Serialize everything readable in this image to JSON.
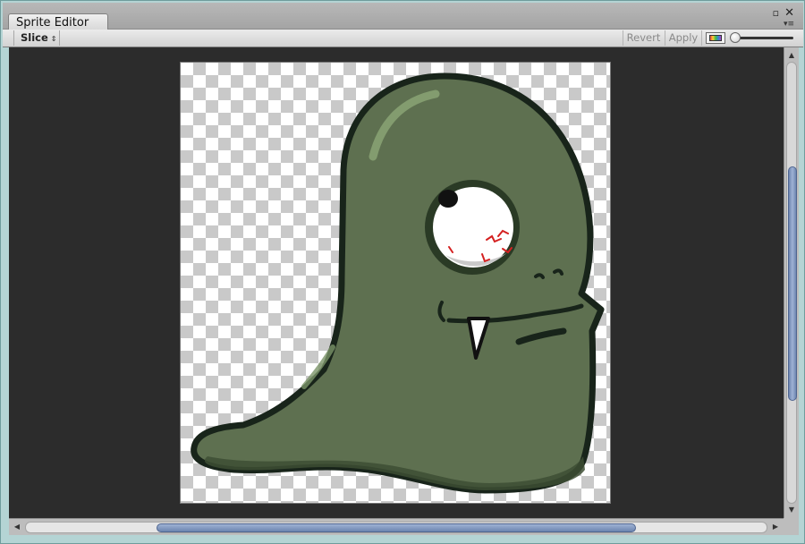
{
  "window": {
    "tab_title": "Sprite Editor",
    "maximize_icon": "maximize-icon",
    "close_icon": "close-icon",
    "menu_icon": "menu-icon"
  },
  "toolbar": {
    "slice_label": "Slice",
    "slice_arrow": "⇕",
    "revert_label": "Revert",
    "apply_label": "Apply",
    "color_toggle_icon": "rgb-channel-icon",
    "zoom_slider_level": 0.05
  },
  "canvas": {
    "background": "transparent-checkerboard",
    "sprite": "green-one-eyed-ghost-monster",
    "colors": {
      "body": "#5e7050",
      "outline": "#18241a",
      "highlight": "#8aa374",
      "eye_white": "#ffffff",
      "veins": "#d42020"
    }
  },
  "scrollbars": {
    "vertical_position": 0.27,
    "horizontal_position": 0.18
  }
}
